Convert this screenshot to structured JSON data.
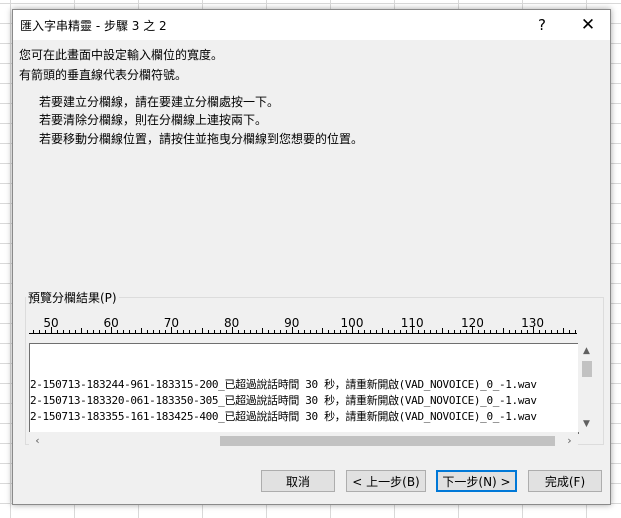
{
  "dialog": {
    "title": "匯入字串精靈 - 步驟 3 之 2",
    "help": "?",
    "close": "✕"
  },
  "intro": {
    "line1": "您可在此畫面中設定輸入欄位的寬度。",
    "line2": "有箭頭的垂直線代表分欄符號。"
  },
  "instructions": [
    "若要建立分欄線，請在要建立分欄處按一下。",
    "若要清除分欄線，則在分欄線上連按兩下。",
    "若要移動分欄線位置，請按住並拖曳分欄線到您想要的位置。"
  ],
  "preview": {
    "label": "預覽分欄結果(P)",
    "ruler": [
      "50",
      "60",
      "70",
      "80",
      "90",
      "100",
      "110",
      "120",
      "130"
    ],
    "lines": [
      "2-150713-183244-961-183315-200_已超過說話時間 30 秒，請重新開啟(VAD_NOVOICE)_0_-1.wav",
      "2-150713-183320-061-183350-305_已超過說話時間 30 秒，請重新開啟(VAD_NOVOICE)_0_-1.wav",
      "2-150713-183355-161-183425-400_已超過說話時間 30 秒，請重新開啟(VAD_NOVOICE)_0_-1.wav"
    ]
  },
  "buttons": {
    "cancel": "取消",
    "back": "< 上一步(B)",
    "next": "下一步(N) >",
    "finish": "完成(F)"
  },
  "colors": {
    "dialog_bg": "#f0f0f0",
    "accent": "#0078d7"
  }
}
